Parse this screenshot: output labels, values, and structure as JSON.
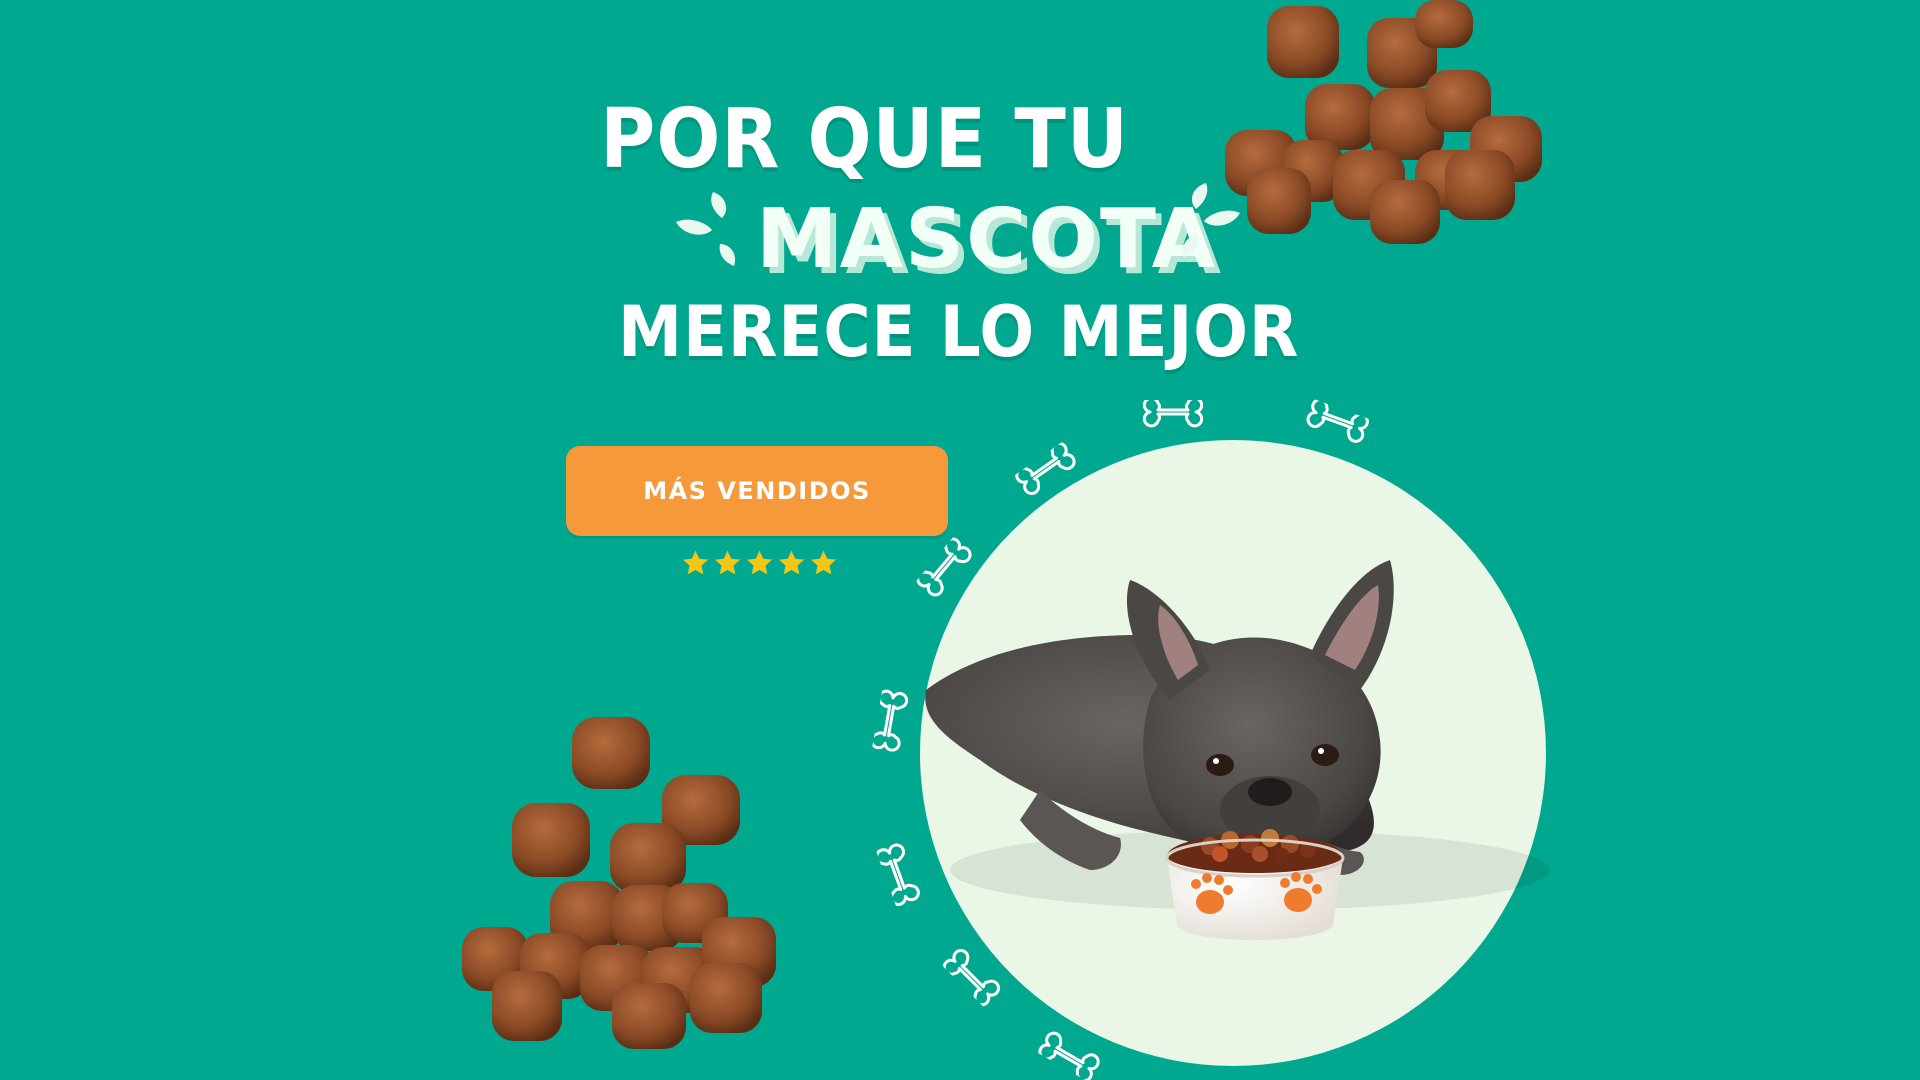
{
  "headline": {
    "line1": "POR QUE TU",
    "line2": "MASCOTA",
    "line3": "MERECE LO MEJOR"
  },
  "cta": {
    "label": "MÁS VENDIDOS"
  },
  "rating": {
    "stars": 5,
    "color": "#f5c518"
  },
  "colors": {
    "background": "#00a88f",
    "button": "#f6993b",
    "circle": "#eaf7e6"
  },
  "icons": {
    "sparkle": "sparkle-icon",
    "bone": "bone-icon",
    "star": "star-icon",
    "paw": "paw-icon"
  }
}
